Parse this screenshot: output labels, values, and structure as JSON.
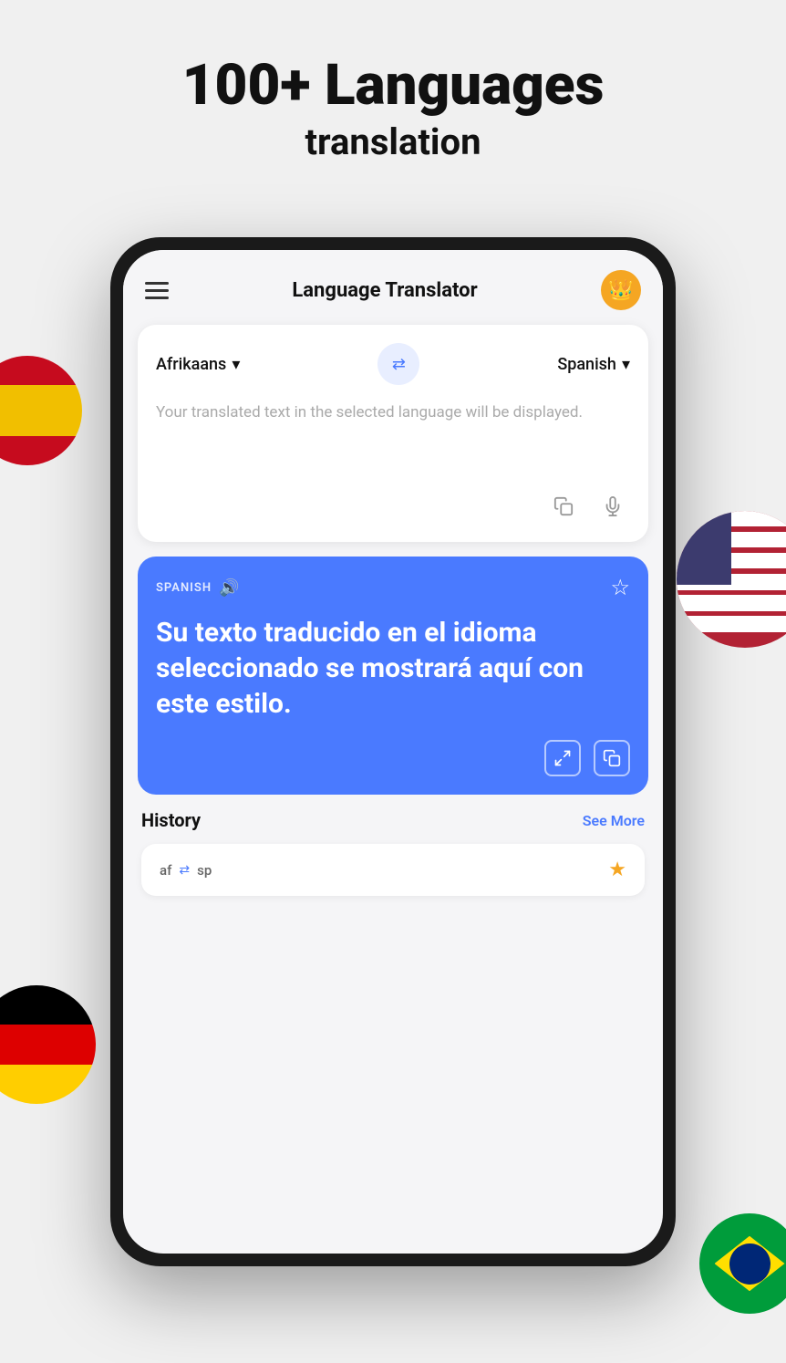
{
  "hero": {
    "line1": "100+ Languages",
    "line2": "translation"
  },
  "app": {
    "title": "Language Translator",
    "crown_emoji": "👑"
  },
  "source_lang": {
    "label": "Afrikaans",
    "code": "af"
  },
  "target_lang": {
    "label": "Spanish",
    "code": "sp"
  },
  "translation_placeholder": "Your translated text in the selected language will be displayed.",
  "result": {
    "lang_label": "SPANISH",
    "text": "Su texto traducido en el idioma seleccionado se mostrará aquí con este estilo."
  },
  "history": {
    "title": "History",
    "see_more": "See More"
  },
  "history_item": {
    "source_code": "af",
    "target_code": "sp"
  }
}
